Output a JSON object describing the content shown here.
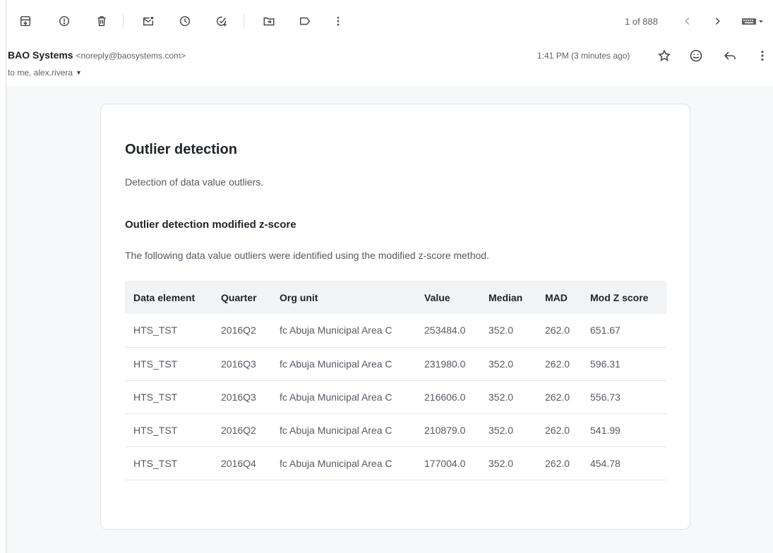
{
  "toolbar": {
    "icons": [
      "archive-icon",
      "report-spam-icon",
      "delete-icon",
      "mark-unread-icon",
      "snooze-icon",
      "add-task-icon",
      "move-to-icon",
      "label-icon",
      "more-icon"
    ],
    "pager_text": "1 of 888"
  },
  "header": {
    "sender_name": "BAO Systems",
    "sender_email": "<noreply@baosystems.com>",
    "recipients": "to me, alex.rivera",
    "time": "1:41 PM (3 minutes ago)"
  },
  "email": {
    "title": "Outlier detection",
    "description": "Detection of data value outliers.",
    "section_title": "Outlier detection modified z-score",
    "section_description": "The following data value outliers were identified using the modified z-score method.",
    "table": {
      "headers": [
        "Data element",
        "Quarter",
        "Org unit",
        "Value",
        "Median",
        "MAD",
        "Mod Z score"
      ],
      "rows": [
        [
          "HTS_TST",
          "2016Q2",
          "fc Abuja Municipal Area C",
          "253484.0",
          "352.0",
          "262.0",
          "651.67"
        ],
        [
          "HTS_TST",
          "2016Q3",
          "fc Abuja Municipal Area C",
          "231980.0",
          "352.0",
          "262.0",
          "596.31"
        ],
        [
          "HTS_TST",
          "2016Q3",
          "fc Abuja Municipal Area C",
          "216606.0",
          "352.0",
          "262.0",
          "556.73"
        ],
        [
          "HTS_TST",
          "2016Q2",
          "fc Abuja Municipal Area C",
          "210879.0",
          "352.0",
          "262.0",
          "541.99"
        ],
        [
          "HTS_TST",
          "2016Q4",
          "fc Abuja Municipal Area C",
          "177004.0",
          "352.0",
          "262.0",
          "454.78"
        ]
      ]
    }
  },
  "colors": {
    "card_bg": "#ffffff",
    "page_bg": "#f7f8f9",
    "table_header_bg": "#f1f3f5",
    "text_primary": "#212529",
    "text_secondary": "#555a60"
  }
}
